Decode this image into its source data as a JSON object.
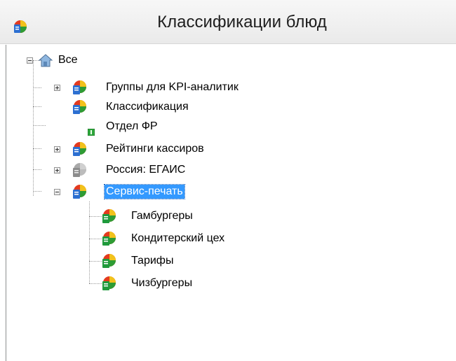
{
  "window": {
    "title": "Классификации блюд",
    "icon": "classification-icon"
  },
  "tree": {
    "root": {
      "label": "Все",
      "icon": "house-icon",
      "expanded": true
    },
    "items": [
      {
        "label": "Группы для KPI-аналитик",
        "icon": "classification-icon",
        "expandable": true,
        "expanded": false
      },
      {
        "label": "Классификация",
        "icon": "classification-icon",
        "expandable": false
      },
      {
        "label": "Отдел ФР",
        "icon": "small-green-square-icon",
        "expandable": false
      },
      {
        "label": "Рейтинги кассиров",
        "icon": "classification-icon",
        "expandable": true,
        "expanded": false
      },
      {
        "label": "Россия: ЕГАИС",
        "icon": "classification-gray-icon",
        "expandable": true,
        "expanded": false
      },
      {
        "label": "Сервис-печать",
        "icon": "classification-icon",
        "expandable": true,
        "expanded": true,
        "selected": true,
        "children": [
          {
            "label": "Гамбургеры",
            "icon": "category-green-icon"
          },
          {
            "label": "Кондитерский цех",
            "icon": "category-green-icon"
          },
          {
            "label": "Тарифы",
            "icon": "category-green-icon"
          },
          {
            "label": "Чизбургеры",
            "icon": "category-green-icon"
          }
        ]
      }
    ]
  },
  "colors": {
    "selection": "#3399ff",
    "header_bg": "#eeeeee"
  }
}
